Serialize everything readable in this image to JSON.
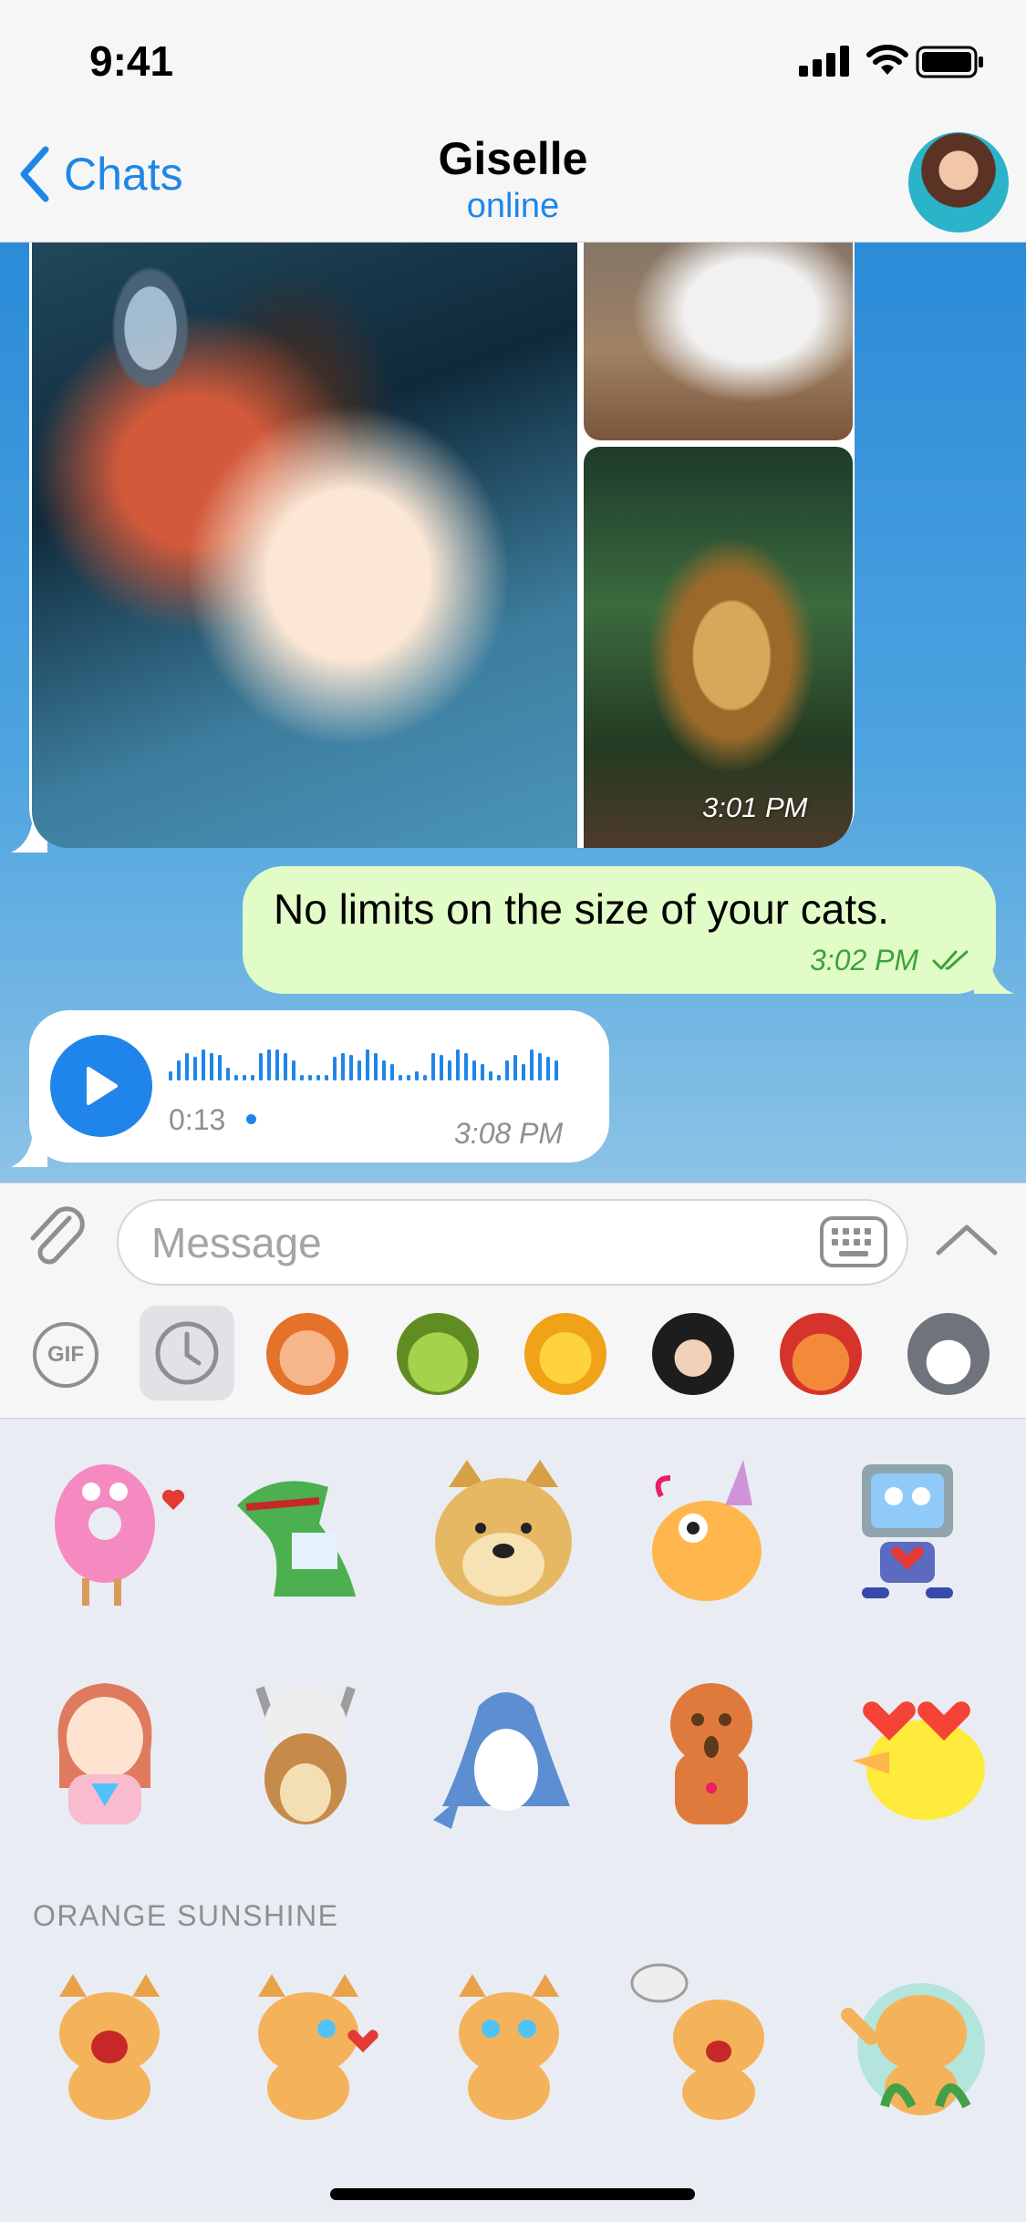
{
  "status_bar": {
    "time": "9:41"
  },
  "header": {
    "back_label": "Chats",
    "title": "Giselle",
    "status": "online"
  },
  "messages": {
    "media_group": {
      "time": "3:01 PM"
    },
    "outgoing_text": {
      "text": "No limits on the size of your cats.",
      "time": "3:02 PM"
    },
    "voice": {
      "duration": "0:13",
      "time": "3:08 PM"
    }
  },
  "input": {
    "placeholder": "Message"
  },
  "sticker_tabs": {
    "gif_label": "GIF"
  },
  "stickers": {
    "section_title": "ORANGE SUNSHINE"
  },
  "colors": {
    "accent": "#1f86e6",
    "outgoing_bubble": "#e2fcc7",
    "outgoing_time": "#3ca23c"
  }
}
